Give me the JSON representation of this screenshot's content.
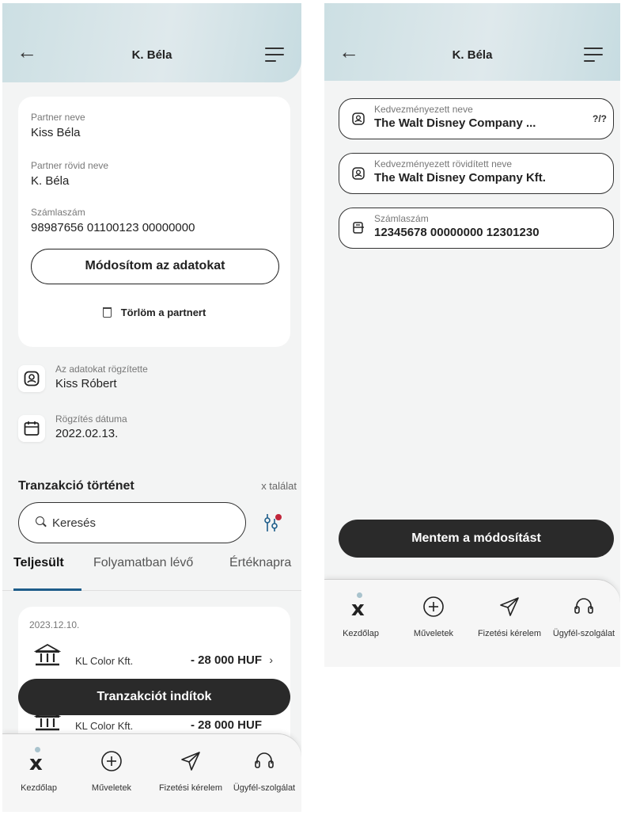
{
  "left": {
    "header": {
      "title": "K. Béla"
    },
    "partner": {
      "name_label": "Partner neve",
      "name_value": "Kiss Béla",
      "short_label": "Partner rövid neve",
      "short_value": "K. Béla",
      "account_label": "Számlaszám",
      "account_value": "98987656 01100123 00000000",
      "edit_button": "Módosítom az adatokat",
      "delete_button": "Törlöm a partnert"
    },
    "recorded_by": {
      "label": "Az adatokat rögzítette",
      "value": "Kiss Róbert"
    },
    "recorded_date": {
      "label": "Rögzítés dátuma",
      "value": "2022.02.13."
    },
    "transactions": {
      "title": "Tranzakció történet",
      "count": "x találat",
      "search_placeholder": "Keresés",
      "tabs": [
        "Teljesült",
        "Folyamatban lévő",
        "Értéknapra"
      ],
      "date": "2023.12.10.",
      "items": [
        {
          "name": "KL Color Kft.",
          "amount": "- 28 000 HUF"
        },
        {
          "name": "KL Color Kft.",
          "amount": "- 28 000 HUF"
        }
      ],
      "start_button": "Tranzakciót indítok"
    }
  },
  "right": {
    "header": {
      "title": "K. Béla"
    },
    "fields": [
      {
        "label": "Kedvezményezett neve",
        "value": "The Walt Disney Company ...",
        "counter": "?/?"
      },
      {
        "label": "Kedvezményezett rövidített neve",
        "value": "The Walt Disney Company Kft."
      },
      {
        "label": "Számlaszám",
        "value": "12345678 00000000 12301230"
      }
    ],
    "save_button": "Mentem a módosítást"
  },
  "nav": [
    {
      "label": "Kezdőlap",
      "icon": "home-logo-icon"
    },
    {
      "label": "Műveletek",
      "icon": "plus-circle-icon"
    },
    {
      "label": "Fizetési kérelem",
      "icon": "paper-plane-icon"
    },
    {
      "label": "Ügyfél-szolgálat",
      "icon": "headset-icon"
    }
  ],
  "colors": {
    "accent": "#1e5d8a",
    "dark_button": "#2a2a2a",
    "header_gradient": "#ccdfe3",
    "notification_dot": "#c0253a"
  }
}
